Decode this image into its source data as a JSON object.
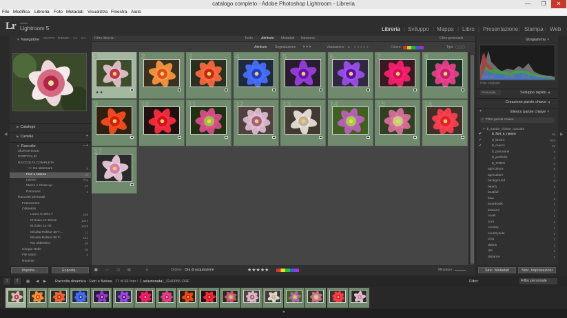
{
  "window": {
    "title": "catalogo completo - Adobe Photoshop Lightroom - Libreria",
    "minimize": "—",
    "maximize": "❐",
    "close": "✕"
  },
  "menu": [
    "File",
    "Modifica",
    "Libreria",
    "Foto",
    "Metadati",
    "Visualizza",
    "Finestra",
    "Aiuto"
  ],
  "identity": {
    "lr": "Lr",
    "adobe": "Adobe",
    "product": "Lightroom 5"
  },
  "modules": [
    "Libreria",
    "Sviluppo",
    "Mappa",
    "Libro",
    "Presentazione",
    "Stampa",
    "Web"
  ],
  "modules_sep": "|",
  "active_module": "Libreria",
  "navigator": {
    "title": "Navigatore",
    "opts": [
      "ADATTA",
      "RIEMPI",
      "1:1",
      "2:1"
    ]
  },
  "left_panels": {
    "catalogo": "Catalogo",
    "cartelle": "Cartelle",
    "raccolte": "Raccolte"
  },
  "collections": [
    {
      "name": "afCROSTOCK",
      "count": "",
      "indent": 1
    },
    {
      "name": "PORTFOLIO",
      "count": "",
      "indent": 1
    },
    {
      "name": "RACCOLTA COMPLETA",
      "count": "",
      "indent": 1
    },
    {
      "name": "-->> Da sistemare",
      "count": "6",
      "indent": 3
    },
    {
      "name": "Fiori e Natura",
      "count": "66",
      "indent": 3,
      "selected": true
    },
    {
      "name": "Lavoro",
      "count": "776",
      "indent": 3
    },
    {
      "name": "Macro e Close-up",
      "count": "16",
      "indent": 3
    },
    {
      "name": "Panorami",
      "count": "2",
      "indent": 3
    },
    {
      "name": "Raccolte personali",
      "count": "",
      "indent": 1
    },
    {
      "name": "Fotocamere",
      "count": "",
      "indent": 2
    },
    {
      "name": "Obbiettivi",
      "count": "",
      "indent": 2
    },
    {
      "name": "Lumix G 20/1.7",
      "count": "195",
      "indent": 4
    },
    {
      "name": "M.Zuiko 12-50mm",
      "count": "1317",
      "indent": 4
    },
    {
      "name": "M.Zuiko 14-42",
      "count": "2049",
      "indent": 4
    },
    {
      "name": "Minolta Rokkor 35-7...",
      "count": "11",
      "indent": 4
    },
    {
      "name": "Minolta Rokkor 50 F...",
      "count": "131",
      "indent": 4
    },
    {
      "name": "NO obbiettivo",
      "count": "26",
      "indent": 4
    },
    {
      "name": "Cinque stelle",
      "count": "35",
      "indent": 2
    },
    {
      "name": "File video",
      "count": "0",
      "indent": 2
    },
    {
      "name": "Recente",
      "count": "",
      "indent": 2
    }
  ],
  "left_buttons": {
    "import": "Importa...",
    "export": "Esporta..."
  },
  "filter_bar": {
    "label": "Filtro libreria :",
    "tabs": [
      "Testo",
      "Attributo",
      "Metadati",
      "Nessuno"
    ],
    "active": "Attributo",
    "preset": "Filtro personale",
    "attr_label": "Attributo",
    "flag": "Segnalazione",
    "rating": "Valutazione",
    "rating_op": "≥",
    "color": "Colore",
    "kind": "Tipo"
  },
  "grid": [
    {
      "num": "1",
      "c1": "#e7c6cf",
      "c2": "#c03050",
      "bg": "#3d4d2a",
      "sel": true,
      "stars": "★ ★"
    },
    {
      "num": "2",
      "c1": "#ff9a40",
      "c2": "#e04a20",
      "bg": "#3a3020"
    },
    {
      "num": "3",
      "c1": "#ff6a40",
      "c2": "#c02a10",
      "bg": "#2a3020"
    },
    {
      "num": "4",
      "c1": "#4a70ff",
      "c2": "#2040c0",
      "bg": "#1c2a3a"
    },
    {
      "num": "5",
      "c1": "#9b40e0",
      "c2": "#6a10b0",
      "bg": "#2a1c30"
    },
    {
      "num": "6",
      "c1": "#a050f0",
      "c2": "#5a10a0",
      "bg": "#302840"
    },
    {
      "num": "7",
      "c1": "#ff2070",
      "c2": "#d01060",
      "bg": "#3a1a20"
    },
    {
      "num": "8",
      "c1": "#f04090",
      "c2": "#c02070",
      "bg": "#1a3020"
    },
    {
      "num": "9",
      "c1": "#ff5020",
      "c2": "#d02010",
      "bg": "#302010"
    },
    {
      "num": "10",
      "c1": "#ff3040",
      "c2": "#d01020",
      "bg": "#201010"
    },
    {
      "num": "11",
      "c1": "#e05090",
      "c2": "#a0c040",
      "bg": "#203010"
    },
    {
      "num": "12",
      "c1": "#e0c0d0",
      "c2": "#a06080",
      "bg": "#504040"
    },
    {
      "num": "13",
      "c1": "#f0e8e0",
      "c2": "#c0b0a0",
      "bg": "#403a30"
    },
    {
      "num": "14",
      "c1": "#c060c0",
      "c2": "#a0d040",
      "bg": "#406020"
    },
    {
      "num": "15",
      "c1": "#e070a0",
      "c2": "#c0d080",
      "bg": "#304020"
    },
    {
      "num": "16",
      "c1": "#ff4050",
      "c2": "#e02030",
      "bg": "#403028"
    },
    {
      "num": "17",
      "c1": "#f0d0e0",
      "c2": "#d080b0",
      "bg": "#2a2a2a"
    }
  ],
  "toolbar": {
    "sort_label": "Ordine:",
    "sort_value": "Ora di acquisizione",
    "stars": "★★★★★",
    "thumbs": "Miniature"
  },
  "right_panels": {
    "histogram": "Istogramma",
    "hist_foot_left": "ISO 200",
    "hist_foot_mid": "12 mm",
    "hist_foot_f": "f/ 5,6",
    "hist_foot_s": "1/1000 sec",
    "hist_orig": "Foto originale",
    "quick_dev": "Sviluppo rapido",
    "quick_dev_preset": "Personale",
    "keywording": "Creazione parole chiave",
    "keyword_list": "Elenco parole chiave",
    "filter_kw": "Filtra parola chiave",
    "kw_root": "$_parole_chiave_raccolte"
  },
  "keywords": [
    {
      "name": "$_fiori_e_natura",
      "count": "66",
      "check": "✔"
    },
    {
      "name": "$_lavoro",
      "count": "934",
      "check": "✔"
    },
    {
      "name": "$_macro",
      "count": "26",
      "check": "✔"
    },
    {
      "name": "$_panorami",
      "count": "2",
      "check": ""
    },
    {
      "name": "$_portfolio",
      "count": "3",
      "check": ""
    },
    {
      "name": "$_TODO",
      "count": "0",
      "check": ""
    },
    {
      "name": "agricoltura",
      "count": "0",
      "check": ""
    },
    {
      "name": "agriculture",
      "count": "1",
      "check": ""
    },
    {
      "name": "background",
      "count": "3",
      "check": ""
    },
    {
      "name": "beach",
      "count": "1",
      "check": ""
    },
    {
      "name": "beatiful",
      "count": "1",
      "check": ""
    },
    {
      "name": "blue",
      "count": "3",
      "check": ""
    },
    {
      "name": "boardwalk",
      "count": "1",
      "check": ""
    },
    {
      "name": "bracioni",
      "count": "1",
      "check": ""
    },
    {
      "name": "coast",
      "count": "1",
      "check": ""
    },
    {
      "name": "corn",
      "count": "1",
      "check": ""
    },
    {
      "name": "country",
      "count": "1",
      "check": ""
    },
    {
      "name": "countryside",
      "count": "1",
      "check": ""
    },
    {
      "name": "crop",
      "count": "1",
      "check": ""
    },
    {
      "name": "debris",
      "count": "1",
      "check": ""
    },
    {
      "name": "dirt",
      "count": "1",
      "check": ""
    },
    {
      "name": "distance",
      "count": "1",
      "check": ""
    }
  ],
  "right_buttons": {
    "sync_meta": "Sinc. Metadati",
    "sync_settings": "Sinc. Impostazioni"
  },
  "filmstrip_bar": {
    "path": "Raccolta dinamica : Fiori e Natura",
    "count": "17 di 66 foto /",
    "selected": "1 selezionata",
    "file": "/_3240056.ORF",
    "filter_label": "Filtro:",
    "filter_value": "Filtro personale",
    "pages": [
      "1",
      "2"
    ]
  },
  "colors": {
    "grid_cell": "#6f8a6c",
    "grid_selected": "#a4b8a0",
    "panel": "#303030",
    "bg": "#2a2a2a"
  }
}
